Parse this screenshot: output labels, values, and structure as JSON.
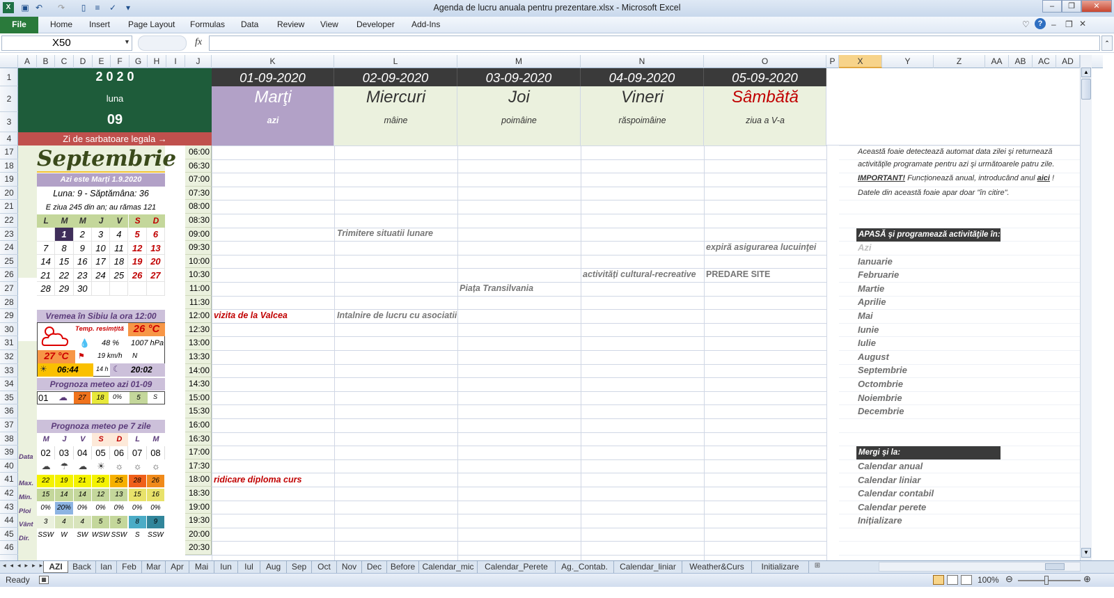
{
  "window": {
    "title": "Agenda de lucru anuala pentru prezentare.xlsx - Microsoft Excel"
  },
  "ribbon": {
    "file": "File",
    "tabs": [
      "Home",
      "Insert",
      "Page Layout",
      "Formulas",
      "Data",
      "Review",
      "View",
      "Developer",
      "Add-Ins"
    ]
  },
  "formula_bar": {
    "name_box": "X50",
    "fx": "fx",
    "value": ""
  },
  "columns": [
    "A",
    "B",
    "C",
    "D",
    "E",
    "F",
    "G",
    "H",
    "I",
    "J",
    "K",
    "L",
    "M",
    "N",
    "O",
    "P",
    "X",
    "Y",
    "Z",
    "AA",
    "AB",
    "AC",
    "AD"
  ],
  "rows": [
    "1",
    "2",
    "3",
    "4",
    "17",
    "18",
    "19",
    "20",
    "21",
    "22",
    "23",
    "24",
    "25",
    "26",
    "27",
    "28",
    "29",
    "30",
    "31",
    "32",
    "33",
    "34",
    "35",
    "36",
    "37",
    "38",
    "39",
    "40",
    "41",
    "42",
    "43",
    "44",
    "45",
    "46"
  ],
  "header": {
    "year": "2 0 2 0",
    "luna_label": "luna",
    "month_num": "09",
    "holiday_link": "Zi de sarbatoare legala →"
  },
  "days": [
    {
      "date": "01-09-2020",
      "name": "Marţi",
      "rel": "azi"
    },
    {
      "date": "02-09-2020",
      "name": "Miercuri",
      "rel": "mâine"
    },
    {
      "date": "03-09-2020",
      "name": "Joi",
      "rel": "poimâine"
    },
    {
      "date": "04-09-2020",
      "name": "Vineri",
      "rel": "răspoimâine"
    },
    {
      "date": "05-09-2020",
      "name": "Sâmbătă",
      "rel": "ziua a V-a"
    }
  ],
  "times": [
    "06:00",
    "06:30",
    "07:00",
    "07:30",
    "08:00",
    "08:30",
    "09:00",
    "09:30",
    "10:00",
    "10:30",
    "11:00",
    "11:30",
    "12:00",
    "12:30",
    "13:00",
    "13:30",
    "14:00",
    "14:30",
    "15:00",
    "15:30",
    "16:00",
    "16:30",
    "17:00",
    "17:30",
    "18:00",
    "18:30",
    "19:00",
    "19:30",
    "20:00",
    "20:30"
  ],
  "events": {
    "e1": "Trimitere situatii lunare",
    "e2": "expiră asigurarea lucuinţei",
    "e3": "activități cultural-recreative",
    "e4": "PREDARE SITE",
    "e5": "Piața Transilvania",
    "e6": "vizita de la Valcea",
    "e7": "Intalnire de lucru cu asociatii",
    "e8": "ridicare diploma curs"
  },
  "calendar": {
    "month_name": "Septembrie",
    "today_line": "Azi este Marți  1.9.2020",
    "week_line": "Luna: 9 - Săptămâna: 36",
    "day_of_year": "E ziua 245 din an; au rămas 121",
    "weekdays": [
      "L",
      "M",
      "M",
      "J",
      "V",
      "S",
      "D"
    ],
    "weeks": [
      [
        "",
        "1",
        "2",
        "3",
        "4",
        "5",
        "6"
      ],
      [
        "7",
        "8",
        "9",
        "10",
        "11",
        "12",
        "13"
      ],
      [
        "14",
        "15",
        "16",
        "17",
        "18",
        "19",
        "20"
      ],
      [
        "21",
        "22",
        "23",
        "24",
        "25",
        "26",
        "27"
      ],
      [
        "28",
        "29",
        "30",
        "",
        "",
        "",
        ""
      ]
    ]
  },
  "weather": {
    "title": "Vremea în Sibiu la ora 12:00",
    "felt_label": "Temp. resimțită",
    "felt": "26 °C",
    "humidity": "48 %",
    "pressure": "1007 hPa",
    "temp": "27 °C",
    "wind": "19 km/h",
    "wind_dir": "N",
    "sunrise": "06:44",
    "daylight": "14 h",
    "sunset": "20:02",
    "today_title": "Prognoza meteo azi 01-09",
    "today": [
      "01",
      "27",
      "18",
      "0%",
      "5",
      "S"
    ],
    "week_title": "Prognoza meteo pe 7 zile",
    "week_days": [
      "M",
      "J",
      "V",
      "S",
      "D",
      "L",
      "M"
    ],
    "row_labels": [
      "Data",
      "Max.",
      "Min.",
      "Ploi",
      "Vânt",
      "Dir."
    ],
    "dates": [
      "02",
      "03",
      "04",
      "05",
      "06",
      "07",
      "08"
    ],
    "max": [
      "22",
      "19",
      "21",
      "23",
      "25",
      "28",
      "26"
    ],
    "min": [
      "15",
      "14",
      "14",
      "12",
      "13",
      "15",
      "16"
    ],
    "rain": [
      "0%",
      "20%",
      "0%",
      "0%",
      "0%",
      "0%",
      "0%"
    ],
    "wind_speed": [
      "3",
      "4",
      "4",
      "5",
      "5",
      "8",
      "9"
    ],
    "dir": [
      "SSW",
      "W",
      "SW",
      "WSW",
      "SSW",
      "S",
      "SSW"
    ]
  },
  "info": {
    "l1": "Această foaie detectează automat data zilei şi returnează",
    "l2": "activităţile programate pentru azi şi următoarele patru zile.",
    "important": "IMPORTANT!",
    "l3": " Funcționează anual, introducând anul ",
    "aici": "aici",
    "l3b": " !",
    "l4": "Datele din această foaie apar doar \"în citire\".",
    "prog_title": "APASĂ şi programează activităţile în:",
    "months": [
      "Azi",
      "Ianuarie",
      "Februarie",
      "Martie",
      "Aprilie",
      "Mai",
      "Iunie",
      "Iulie",
      "August",
      "Septembrie",
      "Octombrie",
      "Noiembrie",
      "Decembrie"
    ],
    "goto_title": "Mergi  şi  la:",
    "goto": [
      "Calendar anual",
      "Calendar liniar",
      "Calendar contabil",
      "Calendar perete",
      "Inițializare"
    ]
  },
  "sheets": [
    "AZI",
    "Back",
    "Ian",
    "Feb",
    "Mar",
    "Apr",
    "Mai",
    "Iun",
    "Iul",
    "Aug",
    "Sep",
    "Oct",
    "Nov",
    "Dec",
    "Before",
    "Calendar_mic",
    "Calendar_Perete",
    "Ag._Contab.",
    "Calendar_liniar",
    "Weather&Curs",
    "Initializare"
  ],
  "status": {
    "ready": "Ready",
    "zoom": "100%"
  },
  "colors": {
    "green_header": "#1e5c3a",
    "dark_header": "#3a3a3a",
    "today_col": "#b2a1c7",
    "day_bg": "#ebf1de",
    "holiday_red": "#c0504d",
    "lavender": "#ccc0da"
  }
}
